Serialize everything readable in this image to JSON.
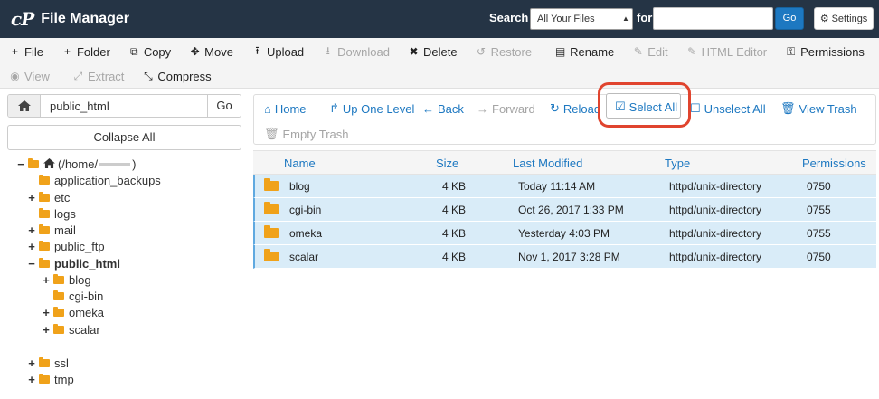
{
  "header": {
    "logo": "cP",
    "title": "File Manager",
    "search_label": "Search",
    "search_scope": "All Your Files",
    "for_label": "for",
    "search_value": "",
    "go_label": "Go",
    "settings_label": "Settings"
  },
  "toolbar": {
    "row1": [
      {
        "label": "File",
        "icon": "plus-icon",
        "glyph": "+",
        "disabled": false
      },
      {
        "label": "Folder",
        "icon": "plus-icon",
        "glyph": "+",
        "disabled": false
      },
      {
        "label": "Copy",
        "icon": "copy-icon",
        "glyph": "⧉",
        "disabled": false
      },
      {
        "label": "Move",
        "icon": "move-icon",
        "glyph": "✥",
        "disabled": false
      },
      {
        "label": "Upload",
        "icon": "upload-icon",
        "glyph": "⭱",
        "disabled": false
      },
      {
        "label": "Download",
        "icon": "download-icon",
        "glyph": "⭳",
        "disabled": true
      },
      {
        "label": "Delete",
        "icon": "delete-icon",
        "glyph": "✖",
        "disabled": false
      },
      {
        "label": "Restore",
        "icon": "restore-icon",
        "glyph": "↺",
        "disabled": true
      },
      {
        "label": "Rename",
        "icon": "file-icon",
        "glyph": "▤",
        "disabled": false
      },
      {
        "label": "Edit",
        "icon": "pencil-icon",
        "glyph": "✎",
        "disabled": true
      },
      {
        "label": "HTML Editor",
        "icon": "html-edit-icon",
        "glyph": "✎",
        "disabled": true
      },
      {
        "label": "Permissions",
        "icon": "key-icon",
        "glyph": "⚿",
        "disabled": false
      }
    ],
    "row2": [
      {
        "label": "View",
        "icon": "eye-icon",
        "glyph": "◉",
        "disabled": true
      },
      {
        "label": "Extract",
        "icon": "expand-icon",
        "glyph": "⤢",
        "disabled": true
      },
      {
        "label": "Compress",
        "icon": "compress-icon",
        "glyph": "⤡",
        "disabled": false
      }
    ]
  },
  "left": {
    "path_value": "public_html",
    "go_label": "Go",
    "collapse_label": "Collapse All",
    "tree": [
      {
        "toggle": "−",
        "label": "(/home/",
        "suffix": ")",
        "kind": "home",
        "bold": false,
        "redacted": true
      },
      {
        "toggle": "",
        "label": "application_backups",
        "kind": "folder",
        "bold": false
      },
      {
        "toggle": "+",
        "label": "etc",
        "kind": "folder",
        "bold": false
      },
      {
        "toggle": "",
        "label": "logs",
        "kind": "folder",
        "bold": false
      },
      {
        "toggle": "+",
        "label": "mail",
        "kind": "folder",
        "bold": false
      },
      {
        "toggle": "+",
        "label": "public_ftp",
        "kind": "folder",
        "bold": false
      },
      {
        "toggle": "−",
        "label": "public_html",
        "kind": "folder",
        "bold": true
      },
      {
        "toggle": "+",
        "label": "blog",
        "kind": "folder",
        "bold": false
      },
      {
        "toggle": "",
        "label": "cgi-bin",
        "kind": "folder",
        "bold": false
      },
      {
        "toggle": "+",
        "label": "omeka",
        "kind": "folder",
        "bold": false
      },
      {
        "toggle": "+",
        "label": "scalar",
        "kind": "folder",
        "bold": false
      },
      {
        "toggle": "+",
        "label": "ssl",
        "kind": "folder",
        "bold": false
      },
      {
        "toggle": "+",
        "label": "tmp",
        "kind": "folder",
        "bold": false
      }
    ]
  },
  "nav": {
    "home": "Home",
    "up": "Up One Level",
    "back": "Back",
    "forward": "Forward",
    "reload": "Reload",
    "select_all": "Select All",
    "unselect_all": "Unselect All",
    "view_trash": "View Trash",
    "empty_trash": "Empty Trash"
  },
  "table": {
    "headers": {
      "name": "Name",
      "size": "Size",
      "modified": "Last Modified",
      "type": "Type",
      "perms": "Permissions"
    },
    "rows": [
      {
        "name": "blog",
        "size": "4 KB",
        "modified": "Today 11:14 AM",
        "type": "httpd/unix-directory",
        "perms": "0750"
      },
      {
        "name": "cgi-bin",
        "size": "4 KB",
        "modified": "Oct 26, 2017 1:33 PM",
        "type": "httpd/unix-directory",
        "perms": "0755"
      },
      {
        "name": "omeka",
        "size": "4 KB",
        "modified": "Yesterday 4:03 PM",
        "type": "httpd/unix-directory",
        "perms": "0755"
      },
      {
        "name": "scalar",
        "size": "4 KB",
        "modified": "Nov 1, 2017 3:28 PM",
        "type": "httpd/unix-directory",
        "perms": "0750"
      }
    ]
  },
  "colors": {
    "header_bg": "#253445",
    "link": "#1d78c1",
    "selected_row": "#d9ecf8",
    "folder": "#f0a21a",
    "highlight": "#e0442e"
  }
}
